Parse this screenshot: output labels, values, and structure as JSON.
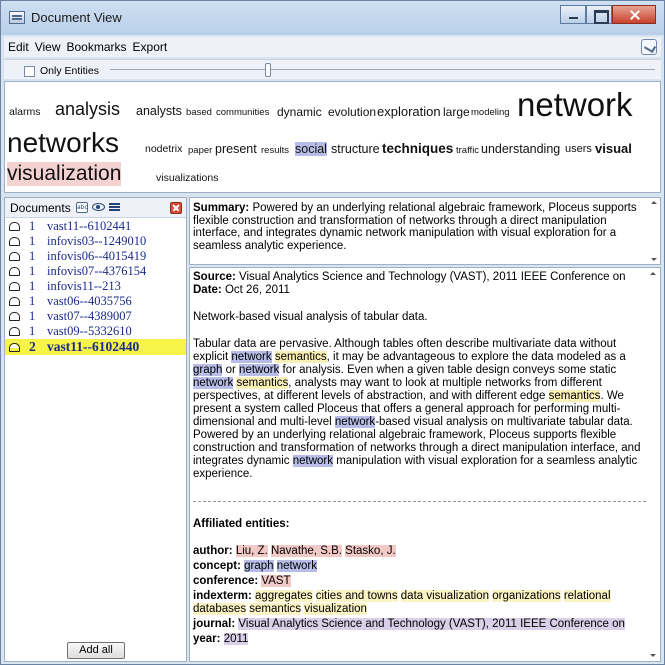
{
  "window": {
    "title": "Document View"
  },
  "menu": [
    "Edit",
    "View",
    "Bookmarks",
    "Export"
  ],
  "filter": {
    "only_entities_label": "Only Entities",
    "only_entities_checked": false,
    "slider_level": 0.29
  },
  "cloud": [
    {
      "text": "alarms",
      "cls": ""
    },
    {
      "text": "analysis",
      "cls": ""
    },
    {
      "text": "analysts",
      "cls": ""
    },
    {
      "text": "based",
      "cls": ""
    },
    {
      "text": "communities",
      "cls": ""
    },
    {
      "text": "dynamic",
      "cls": ""
    },
    {
      "text": "evolution",
      "cls": ""
    },
    {
      "text": "exploration",
      "cls": ""
    },
    {
      "text": "large",
      "cls": ""
    },
    {
      "text": "modeling",
      "cls": ""
    },
    {
      "text": "network",
      "cls": ""
    },
    {
      "text": "networks",
      "cls": ""
    },
    {
      "text": "nodetrix",
      "cls": ""
    },
    {
      "text": "paper",
      "cls": ""
    },
    {
      "text": "present",
      "cls": ""
    },
    {
      "text": "results",
      "cls": ""
    },
    {
      "text": "social",
      "cls": "hl-social"
    },
    {
      "text": "structure",
      "cls": ""
    },
    {
      "text": "techniques",
      "cls": ""
    },
    {
      "text": "traffic",
      "cls": ""
    },
    {
      "text": "understanding",
      "cls": ""
    },
    {
      "text": "users",
      "cls": ""
    },
    {
      "text": "visual",
      "cls": ""
    },
    {
      "text": "visualization",
      "cls": "hl-vis"
    },
    {
      "text": "visualizations",
      "cls": ""
    }
  ],
  "documents": {
    "title": "Documents",
    "items": [
      {
        "count": "1",
        "id": "vast11--6102441",
        "selected": false
      },
      {
        "count": "1",
        "id": "infovis03--1249010",
        "selected": false
      },
      {
        "count": "1",
        "id": "infovis06--4015419",
        "selected": false
      },
      {
        "count": "1",
        "id": "infovis07--4376154",
        "selected": false
      },
      {
        "count": "1",
        "id": "infovis11--213",
        "selected": false
      },
      {
        "count": "1",
        "id": "vast06--4035756",
        "selected": false
      },
      {
        "count": "1",
        "id": "vast07--4389007",
        "selected": false
      },
      {
        "count": "1",
        "id": "vast09--5332610",
        "selected": false
      },
      {
        "count": "2",
        "id": "vast11--6102440",
        "selected": true
      }
    ],
    "add_all_label": "Add all"
  },
  "summary": {
    "label": "Summary:",
    "text": " Powered by an underlying relational algebraic framework, Ploceus supports flexible construction and transformation of networks through a direct manipulation interface, and integrates dynamic network manipulation with visual exploration for a seamless analytic experience."
  },
  "doc": {
    "source_label": "Source:",
    "source_text": " Visual Analytics Science and Technology (VAST), 2011 IEEE Conference on",
    "date_label": "Date:",
    "date_text": " Oct 26, 2011",
    "title_line": "Network-based visual analysis of tabular data.",
    "abstract": [
      {
        "t": "Tabular data are pervasive. Although tables often describe multivariate data without explicit "
      },
      {
        "t": "network",
        "h": "hl-net"
      },
      {
        "t": " "
      },
      {
        "t": "semantics",
        "h": "hl-sem"
      },
      {
        "t": ", it may be advantageous to explore the data modeled as a "
      },
      {
        "t": "graph",
        "h": "hl-net"
      },
      {
        "t": " or "
      },
      {
        "t": "network",
        "h": "hl-net"
      },
      {
        "t": " for analysis. Even when a given table design conveys some static "
      },
      {
        "t": "network",
        "h": "hl-net"
      },
      {
        "t": " "
      },
      {
        "t": "semantics",
        "h": "hl-sem"
      },
      {
        "t": ", analysts may want to look at multiple networks from different perspectives, at different levels of abstraction, and with different edge "
      },
      {
        "t": "semantics",
        "h": "hl-sem"
      },
      {
        "t": ". We present a system called Ploceus that offers a general approach for performing multi-dimensional and multi-level "
      },
      {
        "t": "network",
        "h": "hl-net"
      },
      {
        "t": "-based visual analysis on multivariate tabular data. Powered by an underlying relational algebraic framework, Ploceus supports flexible construction and transformation of networks through a direct manipulation interface, and integrates dynamic "
      },
      {
        "t": "network",
        "h": "hl-net"
      },
      {
        "t": " manipulation with visual exploration for a seamless analytic experience."
      }
    ],
    "affiliated_label": "Affiliated entities:",
    "entities": [
      {
        "label": "author:",
        "values": [
          {
            "t": "Liu, Z.",
            "h": "hl-pink"
          },
          {
            "t": "Navathe, S.B.",
            "h": "hl-pink"
          },
          {
            "t": "Stasko, J.",
            "h": "hl-pink"
          }
        ]
      },
      {
        "label": "concept:",
        "values": [
          {
            "t": "graph",
            "h": "hl-net"
          },
          {
            "t": "network",
            "h": "hl-net"
          }
        ]
      },
      {
        "label": "conference:",
        "values": [
          {
            "t": "VAST",
            "h": "hl-pink"
          }
        ]
      },
      {
        "label": "indexterm:",
        "values": [
          {
            "t": "aggregates",
            "h": "hl-yel"
          },
          {
            "t": "cities and towns",
            "h": "hl-yel"
          },
          {
            "t": "data visualization",
            "h": "hl-yel"
          },
          {
            "t": "organizations",
            "h": "hl-yel"
          },
          {
            "t": "relational databases",
            "h": "hl-yel"
          },
          {
            "t": "semantics",
            "h": "hl-yel"
          },
          {
            "t": "visualization",
            "h": "hl-yel"
          }
        ]
      },
      {
        "label": "journal:",
        "values": [
          {
            "t": "Visual Analytics Science and Technology (VAST), 2011 IEEE Conference on",
            "h": "hl-purp"
          }
        ]
      },
      {
        "label": "year:",
        "values": [
          {
            "t": "2011",
            "h": "hl-purp"
          }
        ]
      }
    ]
  }
}
